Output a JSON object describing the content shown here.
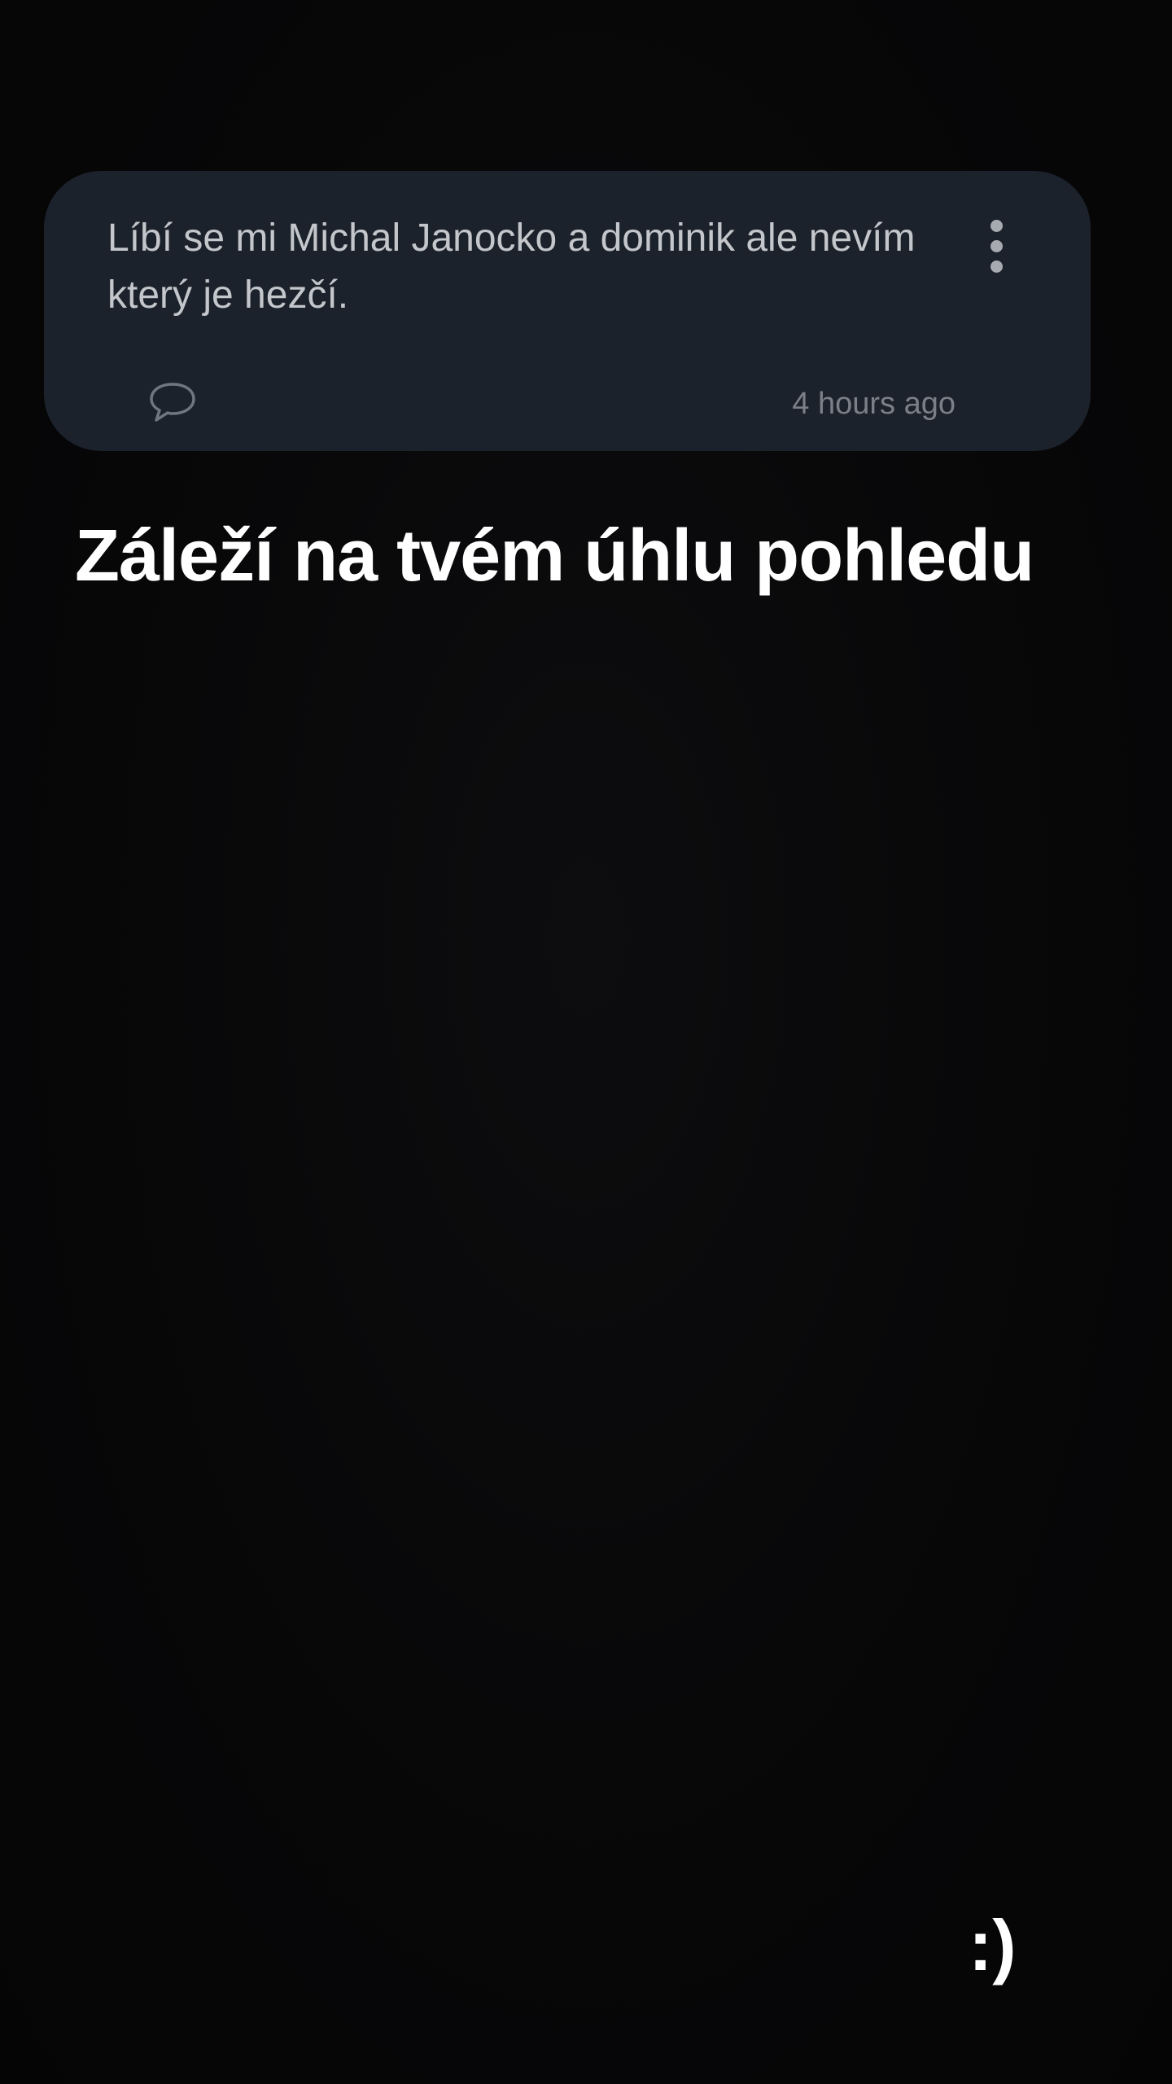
{
  "question": {
    "text": "Líbí se mi Michal Janocko a dominik ale nevím který je hezčí.",
    "timestamp": "4 hours ago",
    "more_icon": "more-vertical-icon",
    "comment_icon": "comment-bubble-icon"
  },
  "answer": {
    "text": "Záleží na tvém úhlu pohledu"
  },
  "sticker": {
    "text": ":)"
  },
  "colors": {
    "background": "#060607",
    "card": "#1c222b",
    "question_text": "#c3c6cb",
    "timestamp": "#7b8088",
    "answer_text": "#ffffff"
  }
}
